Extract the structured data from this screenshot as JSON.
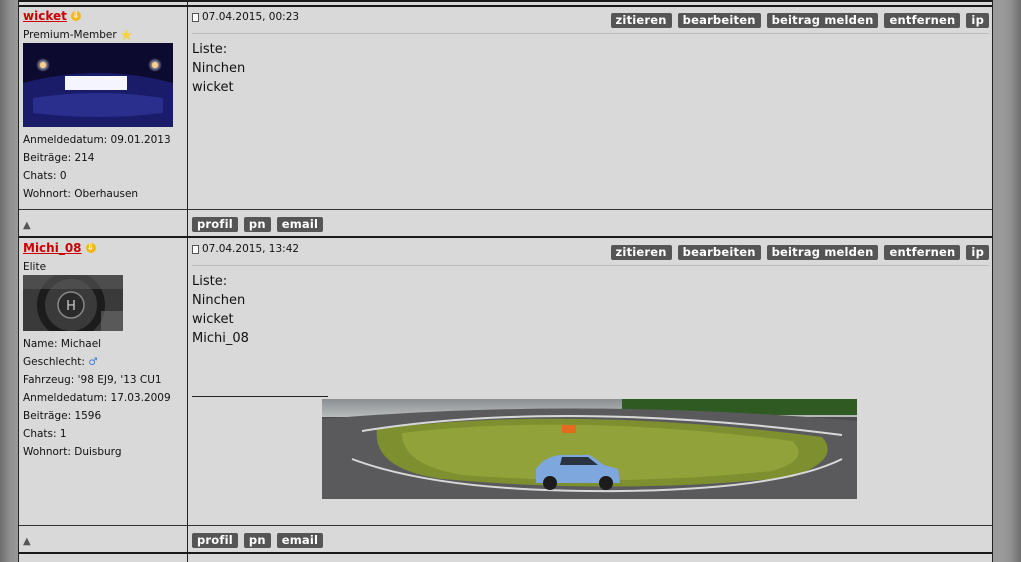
{
  "posts": [
    {
      "username": "wicket",
      "rank": "Premium-Member",
      "info": [
        "Anmeldedatum: 09.01.2013",
        "Beiträge: 214",
        "Chats: 0",
        "Wohnort: Oberhausen"
      ],
      "date": "07.04.2015, 00:23",
      "body": [
        "Liste:",
        "Ninchen",
        "wicket"
      ]
    },
    {
      "username": "Michi_08",
      "rank": "Elite",
      "info": [
        "Name: Michael",
        "Geschlecht: ♂",
        "Fahrzeug: '98 EJ9, '13 CU1",
        "Anmeldedatum: 17.03.2009",
        "Beiträge: 1596",
        "Chats: 1",
        "Wohnort: Duisburg"
      ],
      "date": "07.04.2015, 13:42",
      "body": [
        "Liste:",
        "Ninchen",
        "wicket",
        "Michi_08"
      ]
    }
  ],
  "actions": {
    "quote": "zitieren",
    "edit": "bearbeiten",
    "report": "beitrag melden",
    "remove": "entfernen",
    "ip": "ip"
  },
  "footer": {
    "profile": "profil",
    "pm": "pn",
    "email": "email"
  },
  "icons": {
    "up": "▲",
    "user_arrow": "⇩",
    "star": "★"
  },
  "colors": {
    "username": "#cc0000",
    "button": "#555555",
    "post_bg": "#d9d9d9"
  }
}
